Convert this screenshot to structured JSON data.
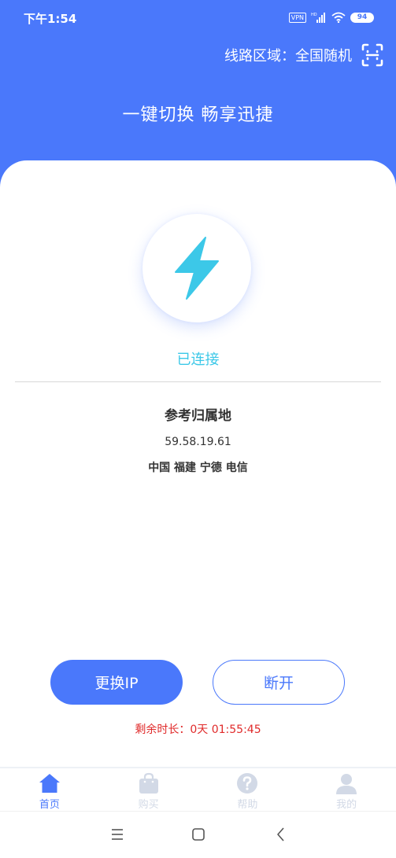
{
  "status_bar": {
    "time": "下午1:54",
    "vpn": "VPN",
    "battery": "94",
    "icons": [
      "vpn-icon",
      "hd-signal-icon",
      "wifi-icon",
      "battery-icon"
    ]
  },
  "header": {
    "region_label": "线路区域：全国随机",
    "slogan": "一键切换 畅享迅捷",
    "scan_icon": "scan-icon"
  },
  "connection": {
    "icon": "lightning-icon",
    "status": "已连接",
    "ref_title": "参考归属地",
    "ip": "59.58.19.61",
    "location": "中国 福建 宁德  电信"
  },
  "actions": {
    "change_ip": "更换IP",
    "disconnect": "断开",
    "remaining": "剩余时长：0天 01:55:45"
  },
  "tabbar": {
    "items": [
      {
        "label": "首页",
        "icon": "home-icon",
        "active": true
      },
      {
        "label": "购买",
        "icon": "shopping-bag-icon",
        "active": false
      },
      {
        "label": "帮助",
        "icon": "help-icon",
        "active": false
      },
      {
        "label": "我的",
        "icon": "user-icon",
        "active": false
      }
    ]
  },
  "colors": {
    "primary": "#4a78fb",
    "connected": "#3cc8e8",
    "remaining": "#e02a2a",
    "inactive_tab": "#d2d9e6"
  }
}
